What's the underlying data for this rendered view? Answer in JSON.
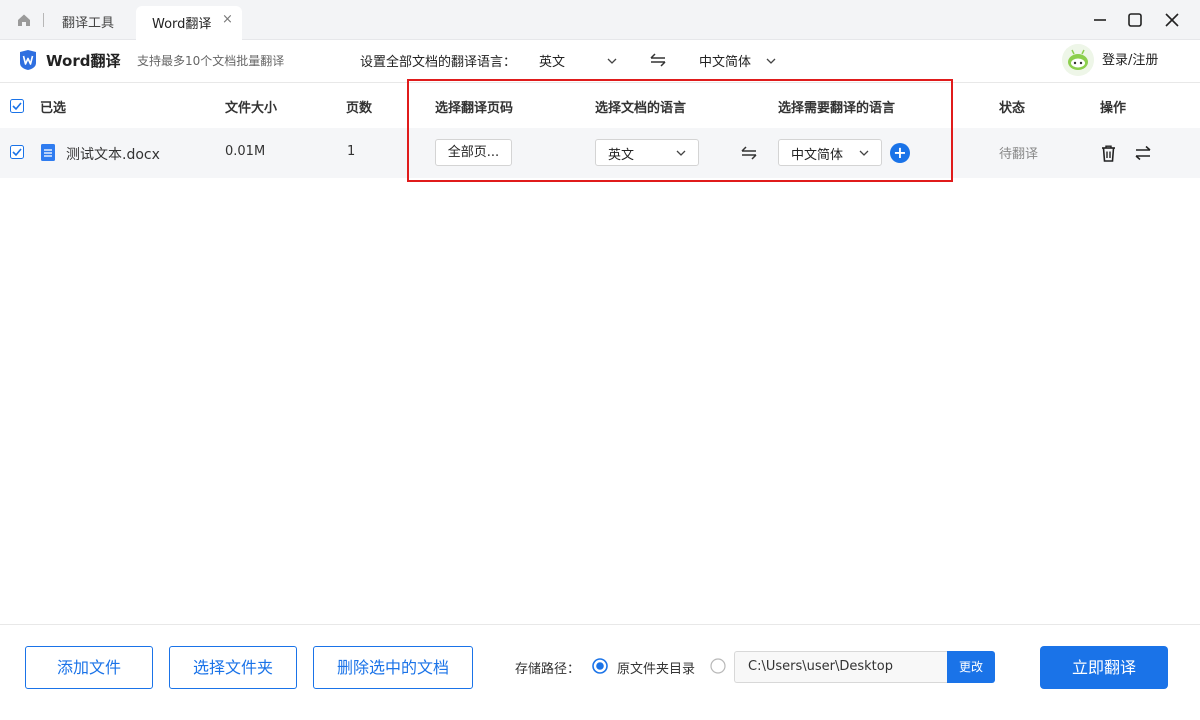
{
  "titlebar": {
    "tab_tools": "翻译工具",
    "tab_active": "Word翻译",
    "tab_close": "×"
  },
  "toolbar": {
    "app_title": "Word翻译",
    "app_subtitle": "支持最多10个文档批量翻译",
    "set_all_label": "设置全部文档的翻译语言：",
    "source_lang": "英文",
    "target_lang": "中文简体",
    "login": "登录/注册"
  },
  "table": {
    "headers": {
      "selected": "已选",
      "size": "文件大小",
      "pages": "页数",
      "page_range": "选择翻译页码",
      "doc_lang": "选择文档的语言",
      "target_lang": "选择需要翻译的语言",
      "status": "状态",
      "actions": "操作"
    },
    "rows": [
      {
        "filename": "测试文本.docx",
        "size": "0.01M",
        "pages": "1",
        "page_range": "全部页...",
        "doc_lang": "英文",
        "target_lang": "中文简体",
        "status": "待翻译"
      }
    ]
  },
  "bottom": {
    "add_file": "添加文件",
    "select_folder": "选择文件夹",
    "delete_selected": "删除选中的文档",
    "storage_label": "存储路径：",
    "original_dir": "原文件夹目录",
    "custom_path": "C:\\Users\\user\\Desktop",
    "change": "更改",
    "translate_now": "立即翻译"
  },
  "colors": {
    "accent": "#1a73e8",
    "highlight_box": "#e01b1b"
  }
}
